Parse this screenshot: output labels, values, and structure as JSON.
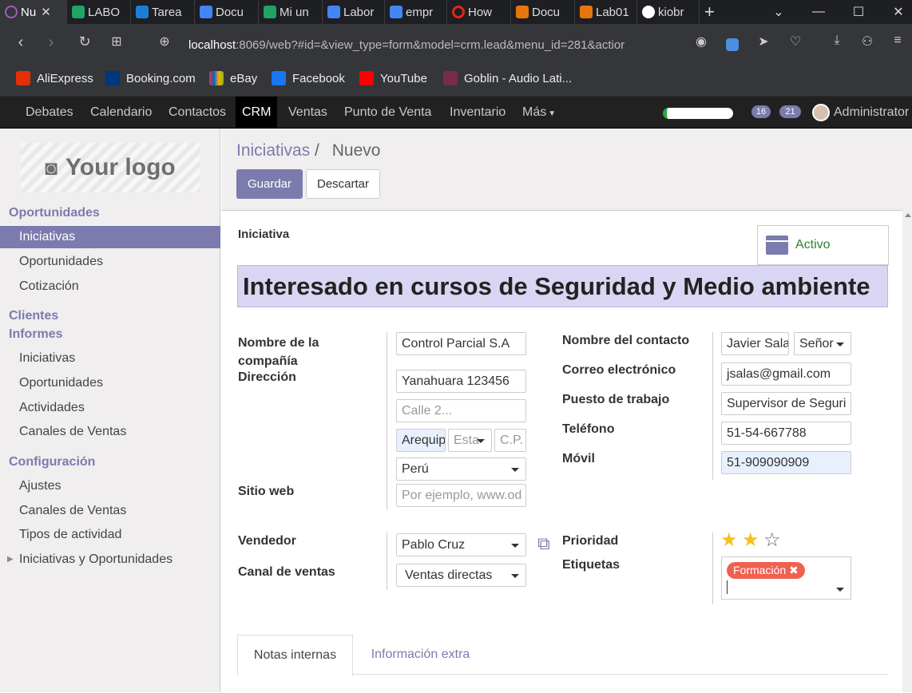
{
  "browser": {
    "tabs": [
      {
        "label": "Nu",
        "color": "#9c5fb5"
      },
      {
        "label": "LABO",
        "color": "#1fa463"
      },
      {
        "label": "Tarea",
        "color": "#1a7fd4"
      },
      {
        "label": "Docu",
        "color": "#4285f4"
      },
      {
        "label": "Mi un",
        "color": "#1fa463"
      },
      {
        "label": "Labor",
        "color": "#4285f4"
      },
      {
        "label": "empr",
        "color": "#4285f4"
      },
      {
        "label": "How",
        "color": "#e0271a"
      },
      {
        "label": "Docu",
        "color": "#e8750a"
      },
      {
        "label": "Lab01",
        "color": "#e8750a"
      },
      {
        "label": "kiobr",
        "color": "#ffffff"
      }
    ],
    "url_host": "localhost",
    "url_rest": ":8069/web?#id=&view_type=form&model=crm.lead&menu_id=281&actior",
    "bookmarks": [
      {
        "label": "AliExpress",
        "color": "#e62e04"
      },
      {
        "label": "Booking.com",
        "color": "#003580"
      },
      {
        "label": "eBay",
        "color": "#e53238"
      },
      {
        "label": "Facebook",
        "color": "#1877f2"
      },
      {
        "label": "YouTube",
        "color": "#ff0000"
      },
      {
        "label": "Goblin - Audio Lati...",
        "color": "#7a2a4a"
      }
    ]
  },
  "topmenu": {
    "items": [
      "Debates",
      "Calendario",
      "Contactos",
      "CRM",
      "Ventas",
      "Punto de Venta",
      "Inventario",
      "Más"
    ],
    "badge_activities": "16",
    "badge_messages": "21",
    "user": "Administrator"
  },
  "sidebar": {
    "logo_text": "Your logo",
    "sections": [
      "Oportunidades",
      "Clientes",
      "Informes",
      "Configuración"
    ],
    "items": [
      "Iniciativas",
      "Oportunidades",
      "Cotización",
      "Iniciativas",
      "Oportunidades",
      "Actividades",
      "Canales de Ventas",
      "Ajustes",
      "Canales de Ventas",
      "Tipos de actividad",
      "Iniciativas y Oportunidades"
    ]
  },
  "main": {
    "breadcrumb_parent": "Iniciativas",
    "breadcrumb_sep": "/",
    "breadcrumb_current": "Nuevo",
    "save_label": "Guardar",
    "discard_label": "Descartar"
  },
  "form": {
    "type_label": "Iniciativa",
    "active_label": "Activo",
    "title": "Interesado en cursos de Seguridad y Medio ambiente",
    "labels": {
      "company": "Nombre de la compañía",
      "address": "Dirección",
      "website": "Sitio web",
      "contact": "Nombre del contacto",
      "email": "Correo electrónico",
      "job": "Puesto de trabajo",
      "phone": "Teléfono",
      "mobile": "Móvil",
      "salesperson": "Vendedor",
      "channel": "Canal de ventas",
      "priority": "Prioridad",
      "tags": "Etiquetas"
    },
    "values": {
      "company": "Control Parcial S.A",
      "street": "Yanahuara 123456",
      "street2_placeholder": "Calle 2...",
      "city": "Arequip",
      "state_placeholder": "Esta",
      "zip_placeholder": "C.P.",
      "country": "Perú",
      "website_placeholder": "Por ejemplo, www.od",
      "contact": "Javier Sala",
      "title": "Señor",
      "email": "jsalas@gmail.com",
      "job": "Supervisor de Seguri",
      "phone": "51-54-667788",
      "mobile": "51-909090909",
      "salesperson": "Pablo Cruz",
      "channel": "Ventas directas",
      "tag": "Formación",
      "priority_stars": 2,
      "priority_max": 3
    },
    "tabs": [
      "Notas internas",
      "Información extra"
    ]
  }
}
